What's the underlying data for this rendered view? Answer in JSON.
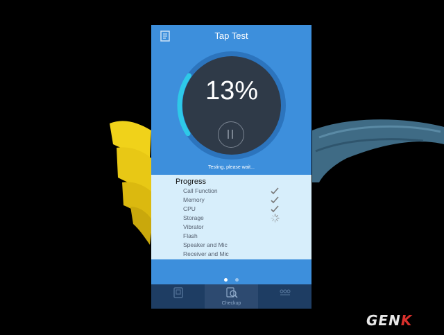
{
  "app": {
    "title": "Tap Test",
    "percent": "13%",
    "progress_fraction": 0.13,
    "status": "Testing, please wait...",
    "accent_color": "#3d8fdc",
    "ring_color": "#2ec9e8"
  },
  "progress": {
    "title": "Progress",
    "items": [
      {
        "label": "Call Function",
        "state": "done",
        "icon": "check-icon"
      },
      {
        "label": "Memory",
        "state": "done",
        "icon": "check-icon"
      },
      {
        "label": "CPU",
        "state": "done",
        "icon": "check-icon"
      },
      {
        "label": "Storage",
        "state": "in-progress",
        "icon": "spinner-icon"
      },
      {
        "label": "Vibrator",
        "state": "pending"
      },
      {
        "label": "Flash",
        "state": "pending"
      },
      {
        "label": "Speaker and Mic",
        "state": "pending"
      },
      {
        "label": "Receiver and Mic",
        "state": "pending"
      }
    ]
  },
  "pager": {
    "count": 2,
    "active": 0
  },
  "tabbar": {
    "tabs": [
      {
        "label": "",
        "icon": "device-icon",
        "active": false
      },
      {
        "label": "Checkup",
        "icon": "magnifier-icon",
        "active": true
      },
      {
        "label": "",
        "icon": "grid-icon",
        "active": false
      }
    ]
  },
  "watermark": {
    "text_main": "GEN",
    "text_accent": "K"
  }
}
